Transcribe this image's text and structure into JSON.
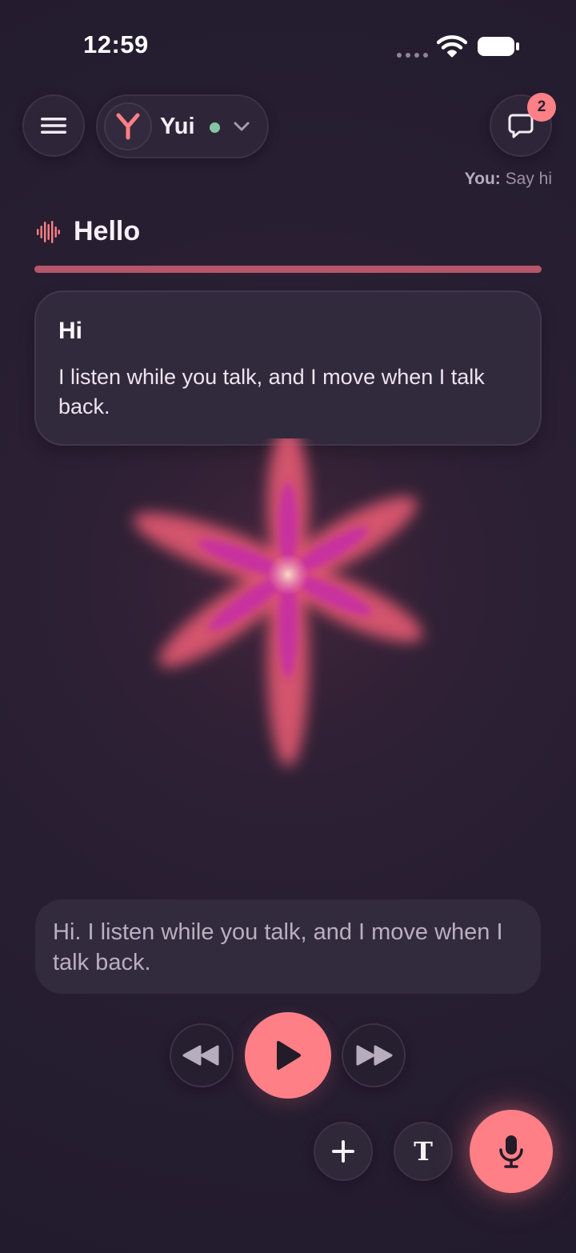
{
  "status_bar": {
    "time": "12:59"
  },
  "header": {
    "menu_icon": "hamburger-menu-icon",
    "assistant": {
      "name": "Yui",
      "avatar_icon": "y-logo-icon",
      "status_color": "#86c4a4",
      "status": "online"
    },
    "chat_icon": "chat-bubble-icon",
    "chat_badge": "2",
    "last_user_message": {
      "label": "You:",
      "text": "Say hi"
    }
  },
  "session": {
    "title": "Hello",
    "title_icon": "audio-wave-icon",
    "progress": 1.0
  },
  "message_card": {
    "title": "Hi",
    "body": "I listen while you talk, and I move when I talk back."
  },
  "transcript": {
    "text": "Hi. I listen while you talk, and I move when I talk back."
  },
  "controls": {
    "rewind_icon": "rewind-icon",
    "play_icon": "play-icon",
    "forward_icon": "fast-forward-icon"
  },
  "actions": {
    "add_icon": "plus-icon",
    "text_label": "T",
    "mic_icon": "microphone-icon"
  },
  "colors": {
    "accent": "#ff7f86",
    "background": "#261e32",
    "card": "#312a3d",
    "progress": "#b5566a"
  }
}
